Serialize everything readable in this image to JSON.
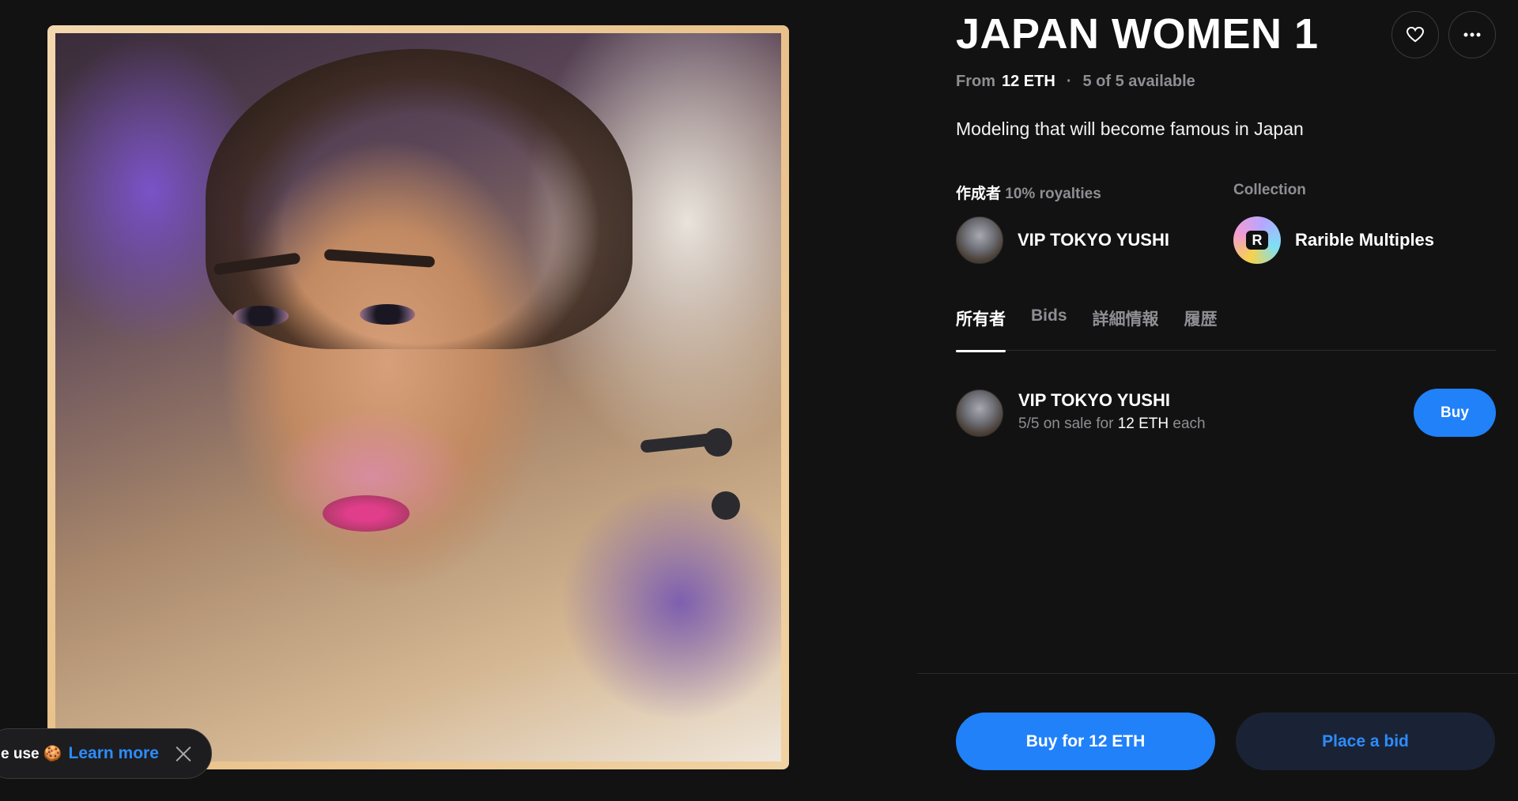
{
  "item": {
    "title": "JAPAN WOMEN 1",
    "price_prefix": "From",
    "price": "12 ETH",
    "separator": "·",
    "availability": "5 of 5 available",
    "description": "Modeling that will become famous in Japan"
  },
  "creator": {
    "label": "作成者",
    "royalties": "10% royalties",
    "name": "VIP TOKYO YUSHI"
  },
  "collection": {
    "label": "Collection",
    "name": "Rarible Multiples",
    "logo_letter": "R"
  },
  "tabs": [
    {
      "label": "所有者",
      "active": true
    },
    {
      "label": "Bids",
      "active": false
    },
    {
      "label": "詳細情報",
      "active": false
    },
    {
      "label": "履歴",
      "active": false
    }
  ],
  "owner": {
    "name": "VIP TOKYO YUSHI",
    "sale_count": "5/5 on sale for",
    "sale_price": "12 ETH",
    "sale_suffix": "each",
    "buy_label": "Buy"
  },
  "actions": {
    "buy_label": "Buy for 12 ETH",
    "bid_label": "Place a bid"
  },
  "cookie": {
    "text": "e use 🍪",
    "link": "Learn more"
  },
  "colors": {
    "accent": "#2081f9",
    "background": "#121212"
  }
}
